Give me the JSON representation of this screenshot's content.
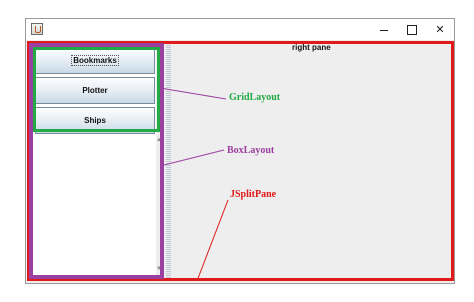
{
  "window": {
    "minimize_glyph": "",
    "close_glyph": "✕"
  },
  "left_pane": {
    "buttons": [
      {
        "label": "Bookmarks"
      },
      {
        "label": "Plotter"
      },
      {
        "label": "Ships"
      }
    ]
  },
  "right_pane": {
    "label": "right pane"
  },
  "annotations": {
    "gridlayout": {
      "label": "GridLayout",
      "color": "#22aa44"
    },
    "boxlayout": {
      "label": "BoxLayout",
      "color": "#9b3fa0"
    },
    "jsplitpane": {
      "label": "JSplitPane",
      "color": "#e01a1a"
    }
  },
  "icons": {
    "app": "java-cup-icon",
    "scroll_up": "scroll-up-arrow-icon",
    "scroll_down": "scroll-down-arrow-icon"
  }
}
